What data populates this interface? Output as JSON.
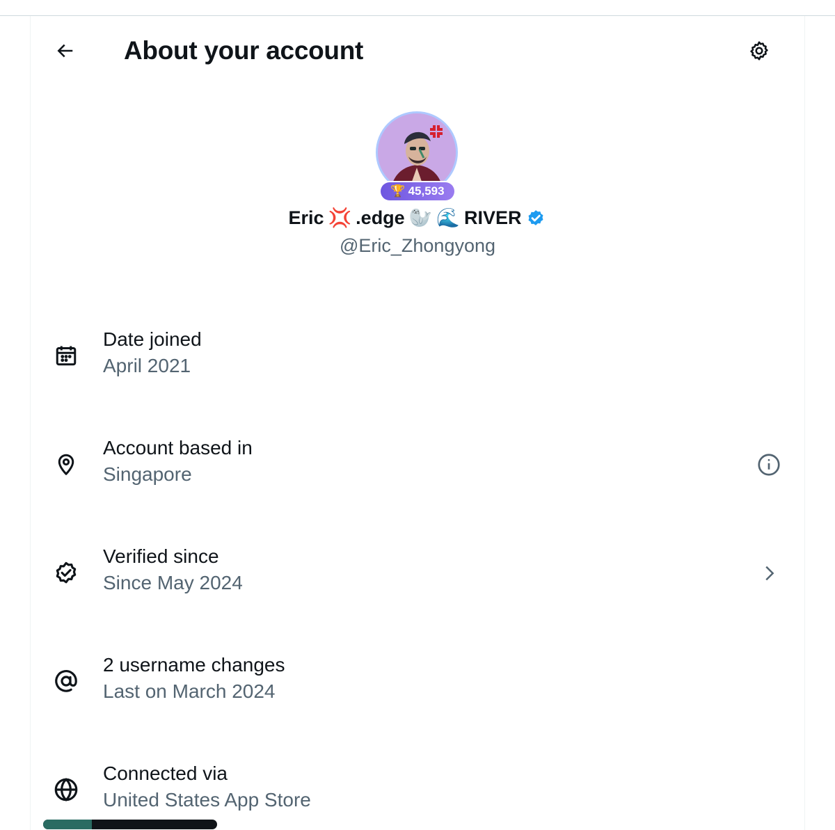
{
  "header": {
    "title": "About your account",
    "back_icon": "arrow-left-icon",
    "settings_icon": "gear-icon"
  },
  "profile": {
    "score": "45,593",
    "name_part1": "Eric",
    "name_part2": ".edge",
    "name_part3": "RIVER",
    "name_emoji1": "💢",
    "name_emoji2": "🦭",
    "name_emoji3": "🌊",
    "handle": "@Eric_Zhongyong",
    "verified_color": "#1d9bf0"
  },
  "rows": [
    {
      "icon": "calendar-icon",
      "label": "Date joined",
      "value": "April 2021"
    },
    {
      "icon": "location-pin-icon",
      "label": "Account based in",
      "value": "Singapore",
      "action_icon": "info-icon"
    },
    {
      "icon": "verified-badge-icon",
      "label": "Verified since",
      "value": "Since May 2024",
      "action_icon": "chevron-right-icon"
    },
    {
      "icon": "at-sign-icon",
      "label": "2 username changes",
      "value": "Last on March 2024"
    },
    {
      "icon": "globe-icon",
      "label": "Connected via",
      "value": "United States App Store"
    }
  ],
  "colors": {
    "text_primary": "#0f1419",
    "text_secondary": "#536471",
    "badge_gradient_start": "#6e57e0",
    "badge_gradient_end": "#9a7cf0"
  }
}
